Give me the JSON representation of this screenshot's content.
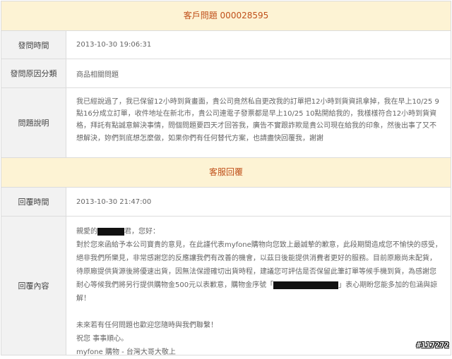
{
  "question": {
    "header": "客戶問題 000028595",
    "rows": {
      "time_label": "發問時間",
      "time_value": "2013-10-30 19:06:31",
      "category_label": "發問原因分類",
      "category_value": "商品相關問題",
      "desc_label": "問題說明",
      "desc_value": "我已經說過了，我已保留12小時到貨畫面，貴公司竟然私自更改我的訂單把12小時到貨資訊拿掉，我在早上10/25 9點16分成立訂單，收件地址在新北市，貴公司連電子發票都是早上10/25 10點開給我的，我樣樣符合12小時到貨資格，拜託有點誠意解決事情，問個問題要四天才回答我，廣告不實跟詐欺是貴公司現在給我的印象，然後出事了又不想解決，妳們到底想怎麼做，如果你們有任何替代方案，也請盡快回覆我，謝謝"
    }
  },
  "service": {
    "header": "客服回覆",
    "time_label": "回覆時間",
    "time_value": "2013-10-30 21:47:00",
    "content_label": "回覆內容",
    "greeting_pre": "親愛的",
    "greeting_post": "君，您好：",
    "body_pre": "對於您來函給予本公司寶貴的意見，在此謹代表myfone購物向您致上最誠摯的歉意，此段期間造成您不愉快的感受，絕非我們所樂見，非常感謝您的反應讓我們有改善的機會，以茲日後能提供消費者更好的服務。目前原廠尚未配貨，待原廠提供貨源後將優速出貨，因無法保證確切出貨時程，建議您可評估是否保留此筆訂單等候手機到貨，為感謝您耐心等候我們將另行提供購物金500元以表歉意，購物金序號「",
    "body_post": "」表心期盼您能多加的包涵與諒解！",
    "closing1": "未來若有任何問題也歡迎您隨時與我們聯繫！",
    "closing2": "祝您 事事順心。",
    "closing3": "myfone 購物 - 台灣大哥大敬上"
  },
  "watermark": "#117272"
}
